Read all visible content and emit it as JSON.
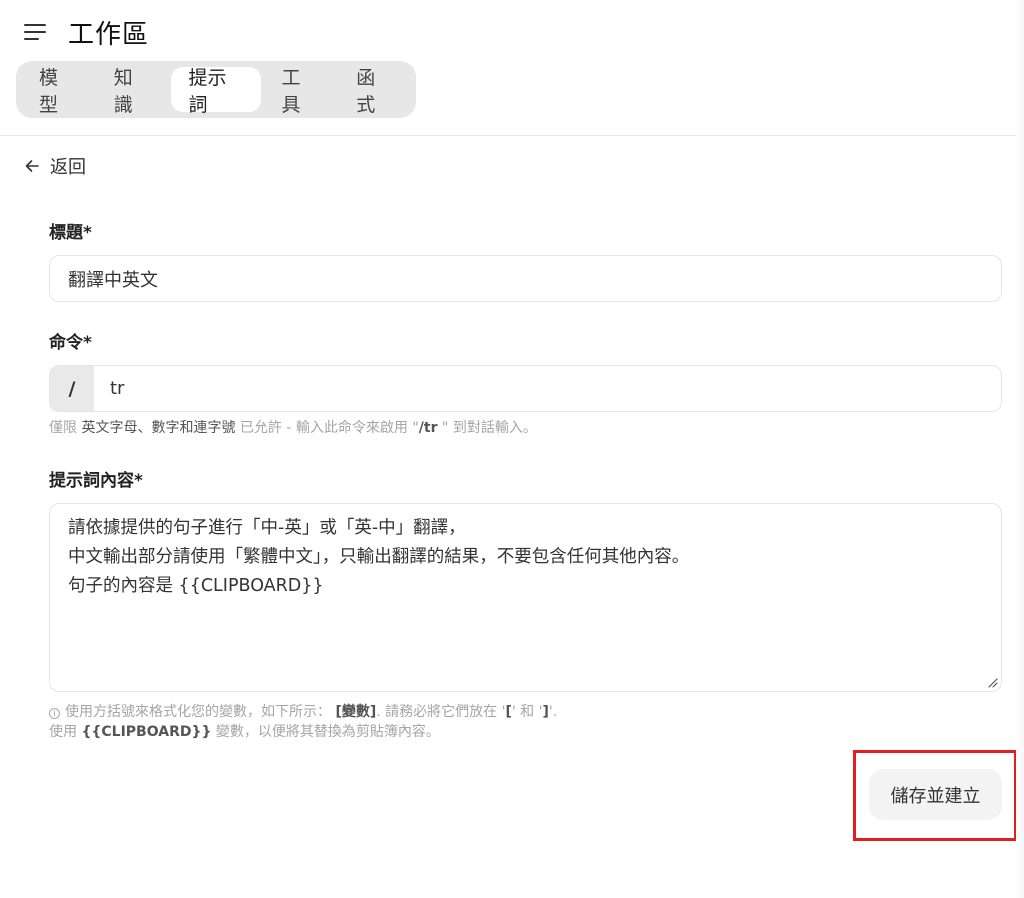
{
  "header": {
    "menu_icon": "hamburger-menu-icon",
    "title": "工作區"
  },
  "tabs": [
    {
      "label": "模型",
      "active": false
    },
    {
      "label": "知識",
      "active": false
    },
    {
      "label": "提示詞",
      "active": true
    },
    {
      "label": "工具",
      "active": false
    },
    {
      "label": "函式",
      "active": false
    }
  ],
  "back": {
    "icon": "arrow-left-icon",
    "label": "返回"
  },
  "form": {
    "title_label": "標題*",
    "title_value": "翻譯中英文",
    "command_label": "命令*",
    "command_prefix": "/",
    "command_value": "tr",
    "command_hint": {
      "part1": "僅限",
      "part2": "英文字母、數字和連字號",
      "part3": "已允許 - 輸入此命令來啟用",
      "part4": "\"",
      "part5": "/tr",
      "part6": " \"",
      "part7": "到對話輸入。"
    },
    "content_label": "提示詞內容*",
    "content_lines": [
      "請依據提供的句子進行「中-英」或「英-中」翻譯，",
      "中文輸出部分請使用「繁體中文」，只輸出翻譯的結果，不要包含任何其他內容。",
      "句子的內容是 {{CLIPBOARD}}"
    ],
    "content_hint": {
      "line1_a": "使用方括號來格式化您的變數，如下所示：",
      "line1_b": "[變數]",
      "line1_c": ". 請務必將它們放在 '",
      "line1_d": "[",
      "line1_e": "' 和 '",
      "line1_f": "]",
      "line1_g": "'.",
      "line2_a": "使用",
      "line2_b": "{{CLIPBOARD}}",
      "line2_c": "變數，以便將其替換為剪貼簿內容。"
    }
  },
  "save_button": {
    "label": "儲存並建立"
  },
  "colors": {
    "highlight": "#e02020",
    "tab_bar": "#e7e7e7",
    "button_bg": "#f3f3f3"
  }
}
